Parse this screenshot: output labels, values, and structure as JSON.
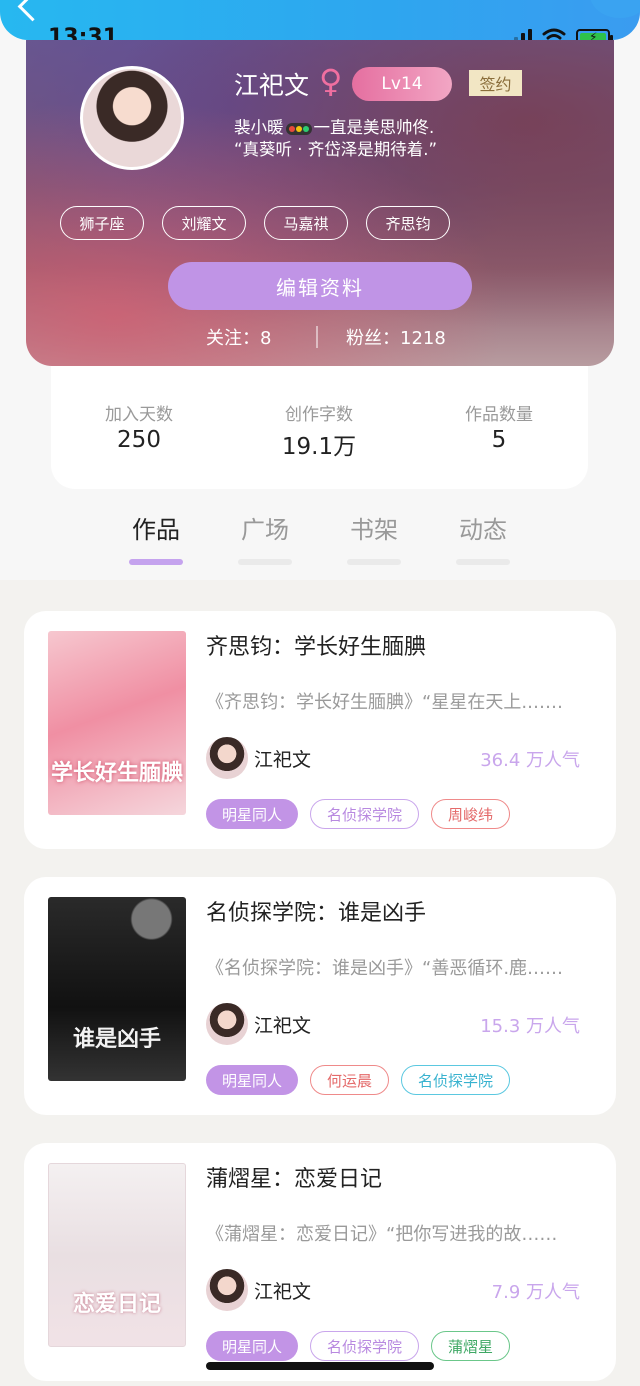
{
  "status_bar": {
    "time": "13:31"
  },
  "profile": {
    "name": "江祀文",
    "level": "Lv14",
    "signed_badge": "签约",
    "bio_line1_a": "裴小暖",
    "bio_line1_b": "一直是美思帅佟.",
    "bio_line2": "“真葵听 · 齐岱泽是期待着.”",
    "tags": [
      "狮子座",
      "刘耀文",
      "马嘉祺",
      "齐思钧"
    ],
    "edit_button": "编辑资料",
    "following_label": "关注：",
    "following_count": "8",
    "followers_label": "粉丝：",
    "followers_count": "1218"
  },
  "stats": [
    {
      "label": "加入天数",
      "value": "250"
    },
    {
      "label": "创作字数",
      "value": "19.1万"
    },
    {
      "label": "作品数量",
      "value": "5"
    }
  ],
  "tabs": [
    "作品",
    "广场",
    "书架",
    "动态"
  ],
  "active_tab": "作品",
  "works": [
    {
      "title": "齐思钧：学长好生腼腆",
      "desc": "《齐思钧：学长好生腼腆》“星星在天上.……",
      "author": "江祀文",
      "popularity": "36.4 万人气",
      "cover_text": "学长好生腼腆",
      "tags": [
        {
          "text": "明星同人",
          "style": "solid"
        },
        {
          "text": "名侦探学院",
          "style": "purple"
        },
        {
          "text": "周峻纬",
          "style": "red"
        }
      ]
    },
    {
      "title": "名侦探学院：谁是凶手",
      "desc": "《名侦探学院：谁是凶手》“善恶循环.鹿……",
      "author": "江祀文",
      "popularity": "15.3 万人气",
      "cover_text": "谁是凶手",
      "tags": [
        {
          "text": "明星同人",
          "style": "solid"
        },
        {
          "text": "何运晨",
          "style": "red"
        },
        {
          "text": "名侦探学院",
          "style": "cyan"
        }
      ]
    },
    {
      "title": "蒲熠星：恋爱日记",
      "desc": "《蒲熠星：恋爱日记》“把你写进我的故……",
      "author": "江祀文",
      "popularity": "7.9 万人气",
      "cover_text": "恋爱日记",
      "tags": [
        {
          "text": "明星同人",
          "style": "solid"
        },
        {
          "text": "名侦探学院",
          "style": "purple"
        },
        {
          "text": "蒲熠星",
          "style": "green"
        }
      ]
    }
  ],
  "colors": {
    "accent": "#c094e6",
    "top_bar": "#2ea6ef",
    "popularity": "#c9a6ec"
  }
}
